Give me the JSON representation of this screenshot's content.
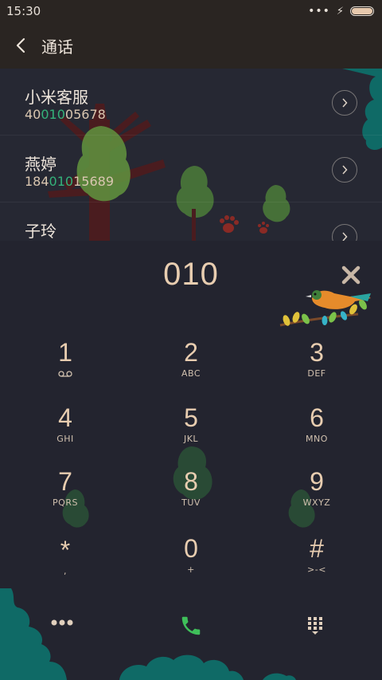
{
  "status_bar": {
    "time": "15:30"
  },
  "header": {
    "title": "通话"
  },
  "results": [
    {
      "name": "小米客服",
      "number_pre": "40",
      "number_match": "010",
      "number_post": "05678"
    },
    {
      "name": "燕婷",
      "number_pre": "184",
      "number_match": "010",
      "number_post": "15689"
    },
    {
      "name": "子玲",
      "number_pre": "",
      "number_match": "",
      "number_post": ""
    }
  ],
  "dialer": {
    "digits": "010",
    "keys": [
      {
        "num": "1",
        "sub": ""
      },
      {
        "num": "2",
        "sub": "ABC"
      },
      {
        "num": "3",
        "sub": "DEF"
      },
      {
        "num": "4",
        "sub": "GHI"
      },
      {
        "num": "5",
        "sub": "JKL"
      },
      {
        "num": "6",
        "sub": "MNO"
      },
      {
        "num": "7",
        "sub": "PQRS"
      },
      {
        "num": "8",
        "sub": "TUV"
      },
      {
        "num": "9",
        "sub": "WXYZ"
      },
      {
        "num": "*",
        "sub": ","
      },
      {
        "num": "0",
        "sub": "+"
      },
      {
        "num": "#",
        "sub": ">-<"
      }
    ]
  },
  "icons": {
    "back": "chevron-left-icon",
    "clear": "close-icon",
    "voicemail": "voicemail-icon",
    "more": "more-dots-icon",
    "call": "phone-icon",
    "keypad": "dialpad-icon"
  },
  "colors": {
    "background": "#23242f",
    "digit": "#e8cdb0",
    "match_highlight": "#34b27a",
    "call_button": "#3fbf5a",
    "foliage": "#0f6a66"
  }
}
